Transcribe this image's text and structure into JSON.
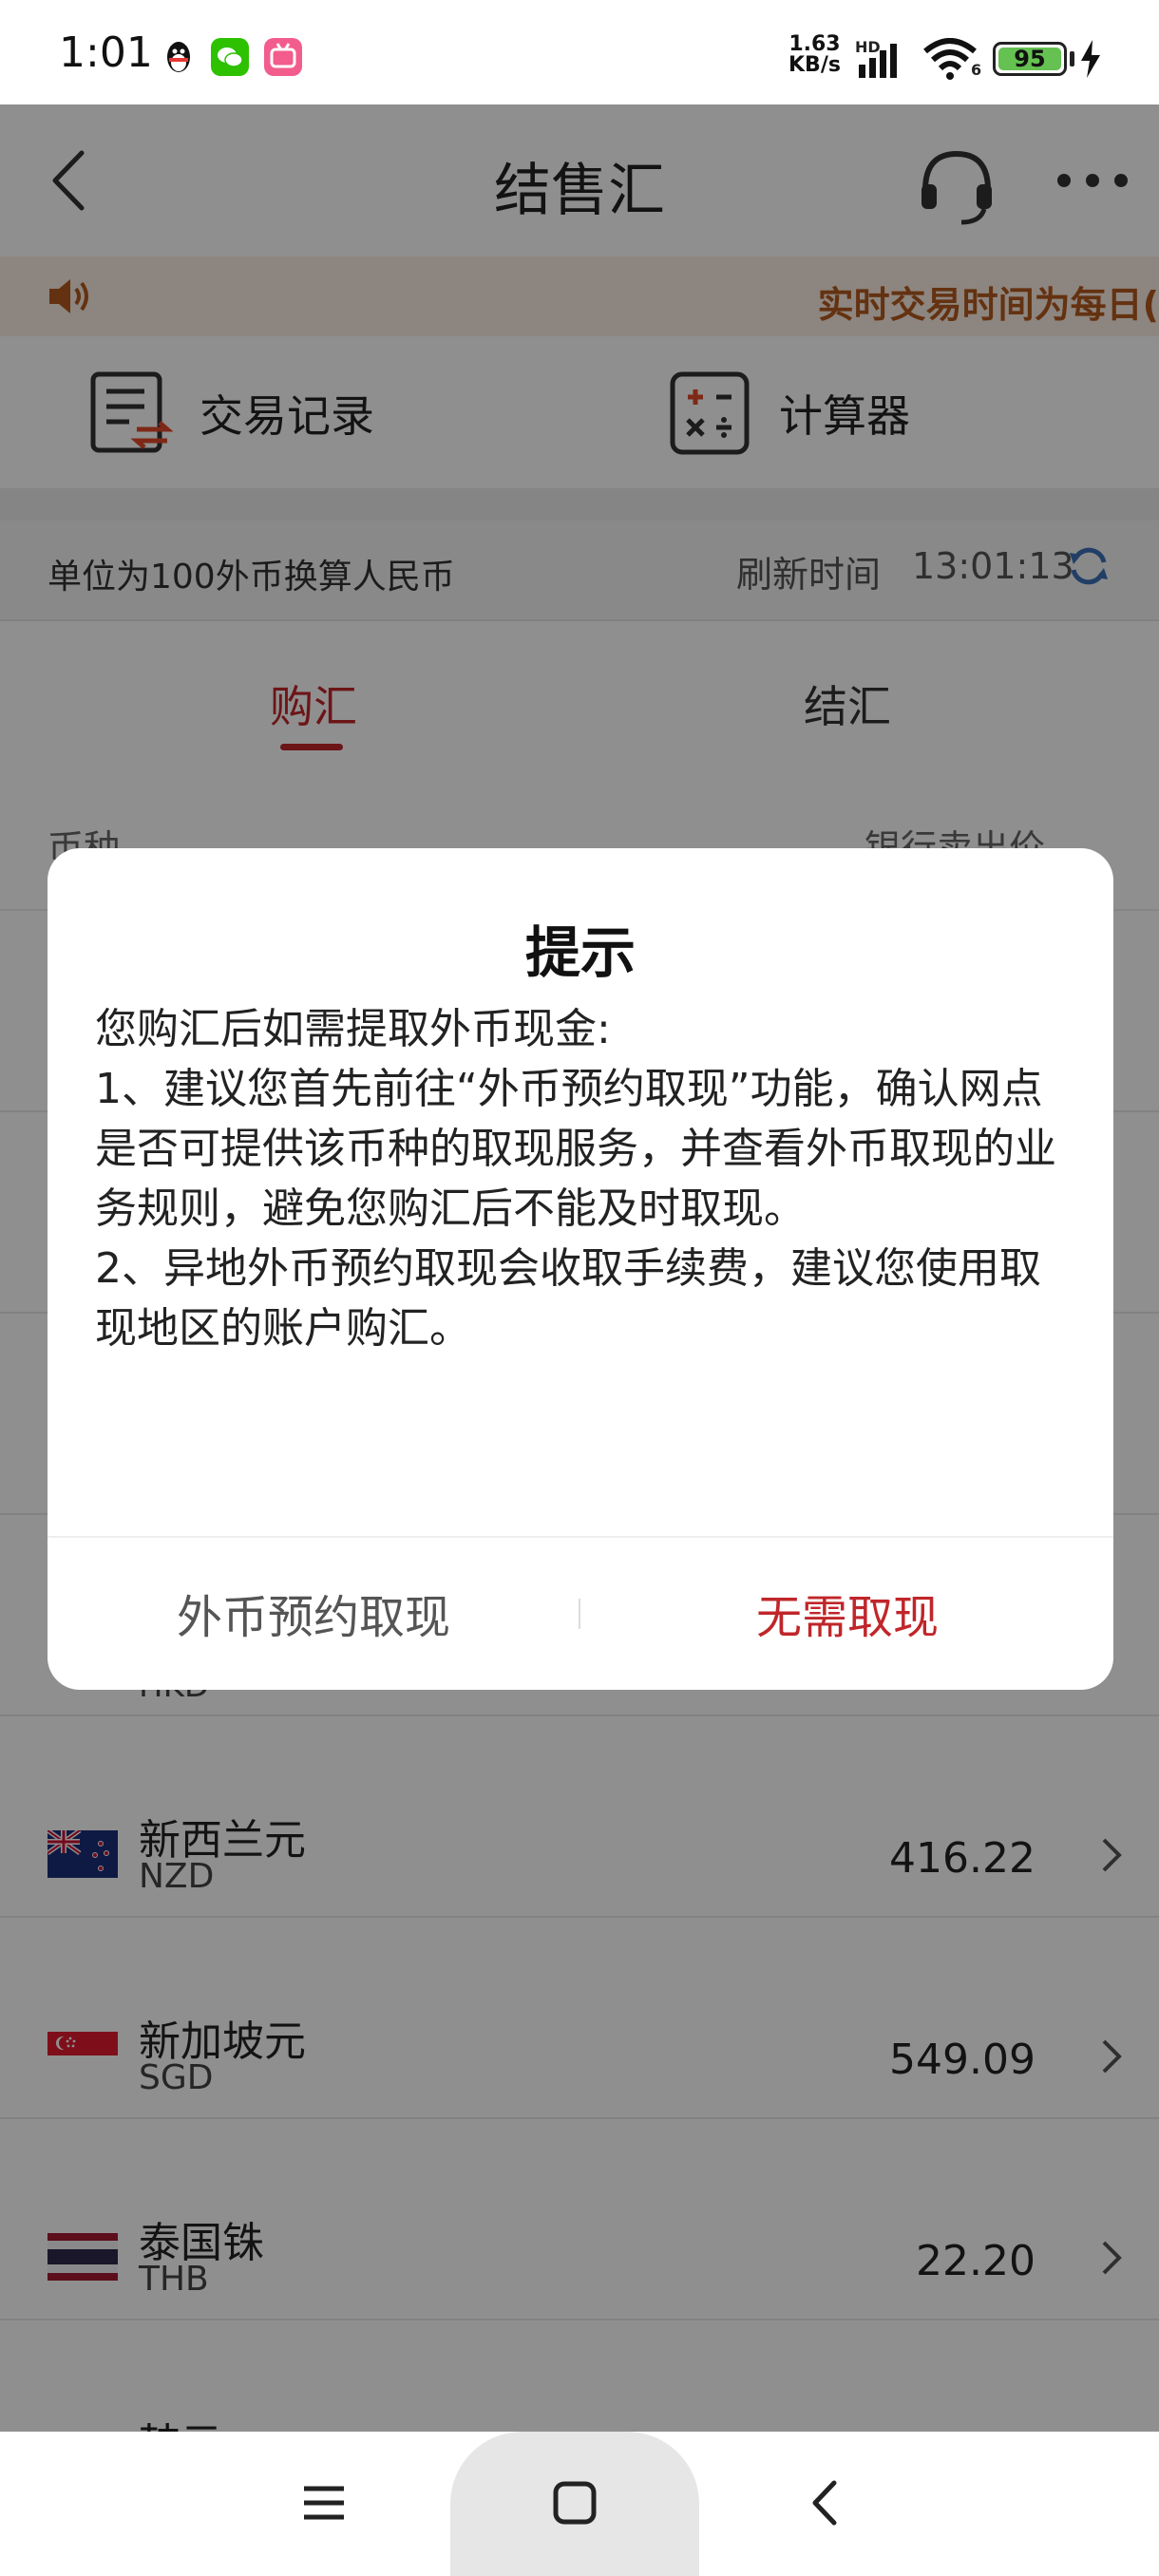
{
  "status_bar": {
    "time": "1:01",
    "net_speed_value": "1.63",
    "net_speed_unit": "KB/s",
    "hd_label": "HD",
    "wifi_label": "6",
    "battery": "95"
  },
  "header": {
    "title": "结售汇"
  },
  "notice": {
    "marquee": "实时交易时间为每日("
  },
  "shortcuts": {
    "records": "交易记录",
    "calculator": "计算器"
  },
  "info_bar": {
    "unit_text": "单位为100外币换算人民币",
    "refresh_label": "刷新时间",
    "refresh_time": "13:01:13"
  },
  "tabs": {
    "buy": "购汇",
    "sell": "结汇"
  },
  "table": {
    "col_currency": "币种",
    "col_price": "银行卖出价",
    "rows": [
      {
        "name": "新西兰元",
        "code": "NZD",
        "value": "416.22"
      },
      {
        "name": "新加坡元",
        "code": "SGD",
        "value": "549.09"
      },
      {
        "name": "泰国铢",
        "code": "THB",
        "value": "22.20"
      },
      {
        "name": "韩元",
        "code": "",
        "value": ""
      }
    ],
    "partial_code": "HKD"
  },
  "dialog": {
    "title": "提示",
    "body": "您购汇后如需提取外币现金:\n1、建议您首先前往“外币预约取现”功能，确认网点是否可提供该币种的取现服务，并查看外币取现的业务规则，避免您购汇后不能及时取现。\n2、异地外币预约取现会收取手续费，建议您使用取现地区的账户购汇。",
    "btn_appointment": "外币预约取现",
    "btn_no_need": "无需取现"
  },
  "colors": {
    "accent": "#c0262a",
    "notice_text": "#b35a1f",
    "notice_bg": "#fbeee2"
  }
}
